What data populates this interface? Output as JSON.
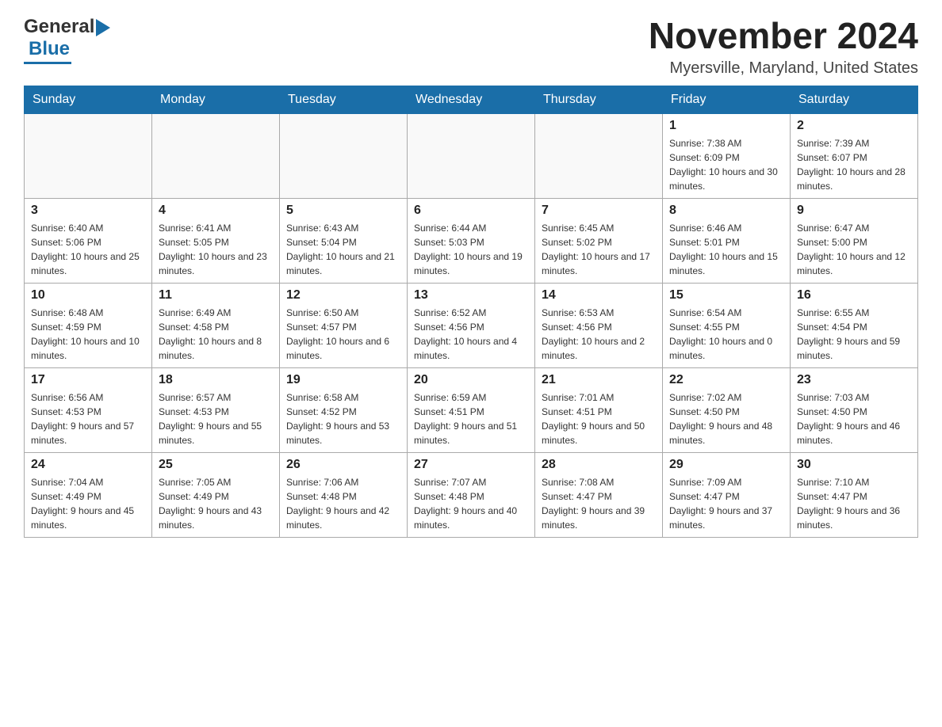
{
  "header": {
    "logo_general": "General",
    "logo_blue": "Blue",
    "month_title": "November 2024",
    "location": "Myersville, Maryland, United States"
  },
  "weekdays": [
    "Sunday",
    "Monday",
    "Tuesday",
    "Wednesday",
    "Thursday",
    "Friday",
    "Saturday"
  ],
  "weeks": [
    [
      {
        "day": "",
        "sunrise": "",
        "sunset": "",
        "daylight": ""
      },
      {
        "day": "",
        "sunrise": "",
        "sunset": "",
        "daylight": ""
      },
      {
        "day": "",
        "sunrise": "",
        "sunset": "",
        "daylight": ""
      },
      {
        "day": "",
        "sunrise": "",
        "sunset": "",
        "daylight": ""
      },
      {
        "day": "",
        "sunrise": "",
        "sunset": "",
        "daylight": ""
      },
      {
        "day": "1",
        "sunrise": "Sunrise: 7:38 AM",
        "sunset": "Sunset: 6:09 PM",
        "daylight": "Daylight: 10 hours and 30 minutes."
      },
      {
        "day": "2",
        "sunrise": "Sunrise: 7:39 AM",
        "sunset": "Sunset: 6:07 PM",
        "daylight": "Daylight: 10 hours and 28 minutes."
      }
    ],
    [
      {
        "day": "3",
        "sunrise": "Sunrise: 6:40 AM",
        "sunset": "Sunset: 5:06 PM",
        "daylight": "Daylight: 10 hours and 25 minutes."
      },
      {
        "day": "4",
        "sunrise": "Sunrise: 6:41 AM",
        "sunset": "Sunset: 5:05 PM",
        "daylight": "Daylight: 10 hours and 23 minutes."
      },
      {
        "day": "5",
        "sunrise": "Sunrise: 6:43 AM",
        "sunset": "Sunset: 5:04 PM",
        "daylight": "Daylight: 10 hours and 21 minutes."
      },
      {
        "day": "6",
        "sunrise": "Sunrise: 6:44 AM",
        "sunset": "Sunset: 5:03 PM",
        "daylight": "Daylight: 10 hours and 19 minutes."
      },
      {
        "day": "7",
        "sunrise": "Sunrise: 6:45 AM",
        "sunset": "Sunset: 5:02 PM",
        "daylight": "Daylight: 10 hours and 17 minutes."
      },
      {
        "day": "8",
        "sunrise": "Sunrise: 6:46 AM",
        "sunset": "Sunset: 5:01 PM",
        "daylight": "Daylight: 10 hours and 15 minutes."
      },
      {
        "day": "9",
        "sunrise": "Sunrise: 6:47 AM",
        "sunset": "Sunset: 5:00 PM",
        "daylight": "Daylight: 10 hours and 12 minutes."
      }
    ],
    [
      {
        "day": "10",
        "sunrise": "Sunrise: 6:48 AM",
        "sunset": "Sunset: 4:59 PM",
        "daylight": "Daylight: 10 hours and 10 minutes."
      },
      {
        "day": "11",
        "sunrise": "Sunrise: 6:49 AM",
        "sunset": "Sunset: 4:58 PM",
        "daylight": "Daylight: 10 hours and 8 minutes."
      },
      {
        "day": "12",
        "sunrise": "Sunrise: 6:50 AM",
        "sunset": "Sunset: 4:57 PM",
        "daylight": "Daylight: 10 hours and 6 minutes."
      },
      {
        "day": "13",
        "sunrise": "Sunrise: 6:52 AM",
        "sunset": "Sunset: 4:56 PM",
        "daylight": "Daylight: 10 hours and 4 minutes."
      },
      {
        "day": "14",
        "sunrise": "Sunrise: 6:53 AM",
        "sunset": "Sunset: 4:56 PM",
        "daylight": "Daylight: 10 hours and 2 minutes."
      },
      {
        "day": "15",
        "sunrise": "Sunrise: 6:54 AM",
        "sunset": "Sunset: 4:55 PM",
        "daylight": "Daylight: 10 hours and 0 minutes."
      },
      {
        "day": "16",
        "sunrise": "Sunrise: 6:55 AM",
        "sunset": "Sunset: 4:54 PM",
        "daylight": "Daylight: 9 hours and 59 minutes."
      }
    ],
    [
      {
        "day": "17",
        "sunrise": "Sunrise: 6:56 AM",
        "sunset": "Sunset: 4:53 PM",
        "daylight": "Daylight: 9 hours and 57 minutes."
      },
      {
        "day": "18",
        "sunrise": "Sunrise: 6:57 AM",
        "sunset": "Sunset: 4:53 PM",
        "daylight": "Daylight: 9 hours and 55 minutes."
      },
      {
        "day": "19",
        "sunrise": "Sunrise: 6:58 AM",
        "sunset": "Sunset: 4:52 PM",
        "daylight": "Daylight: 9 hours and 53 minutes."
      },
      {
        "day": "20",
        "sunrise": "Sunrise: 6:59 AM",
        "sunset": "Sunset: 4:51 PM",
        "daylight": "Daylight: 9 hours and 51 minutes."
      },
      {
        "day": "21",
        "sunrise": "Sunrise: 7:01 AM",
        "sunset": "Sunset: 4:51 PM",
        "daylight": "Daylight: 9 hours and 50 minutes."
      },
      {
        "day": "22",
        "sunrise": "Sunrise: 7:02 AM",
        "sunset": "Sunset: 4:50 PM",
        "daylight": "Daylight: 9 hours and 48 minutes."
      },
      {
        "day": "23",
        "sunrise": "Sunrise: 7:03 AM",
        "sunset": "Sunset: 4:50 PM",
        "daylight": "Daylight: 9 hours and 46 minutes."
      }
    ],
    [
      {
        "day": "24",
        "sunrise": "Sunrise: 7:04 AM",
        "sunset": "Sunset: 4:49 PM",
        "daylight": "Daylight: 9 hours and 45 minutes."
      },
      {
        "day": "25",
        "sunrise": "Sunrise: 7:05 AM",
        "sunset": "Sunset: 4:49 PM",
        "daylight": "Daylight: 9 hours and 43 minutes."
      },
      {
        "day": "26",
        "sunrise": "Sunrise: 7:06 AM",
        "sunset": "Sunset: 4:48 PM",
        "daylight": "Daylight: 9 hours and 42 minutes."
      },
      {
        "day": "27",
        "sunrise": "Sunrise: 7:07 AM",
        "sunset": "Sunset: 4:48 PM",
        "daylight": "Daylight: 9 hours and 40 minutes."
      },
      {
        "day": "28",
        "sunrise": "Sunrise: 7:08 AM",
        "sunset": "Sunset: 4:47 PM",
        "daylight": "Daylight: 9 hours and 39 minutes."
      },
      {
        "day": "29",
        "sunrise": "Sunrise: 7:09 AM",
        "sunset": "Sunset: 4:47 PM",
        "daylight": "Daylight: 9 hours and 37 minutes."
      },
      {
        "day": "30",
        "sunrise": "Sunrise: 7:10 AM",
        "sunset": "Sunset: 4:47 PM",
        "daylight": "Daylight: 9 hours and 36 minutes."
      }
    ]
  ]
}
